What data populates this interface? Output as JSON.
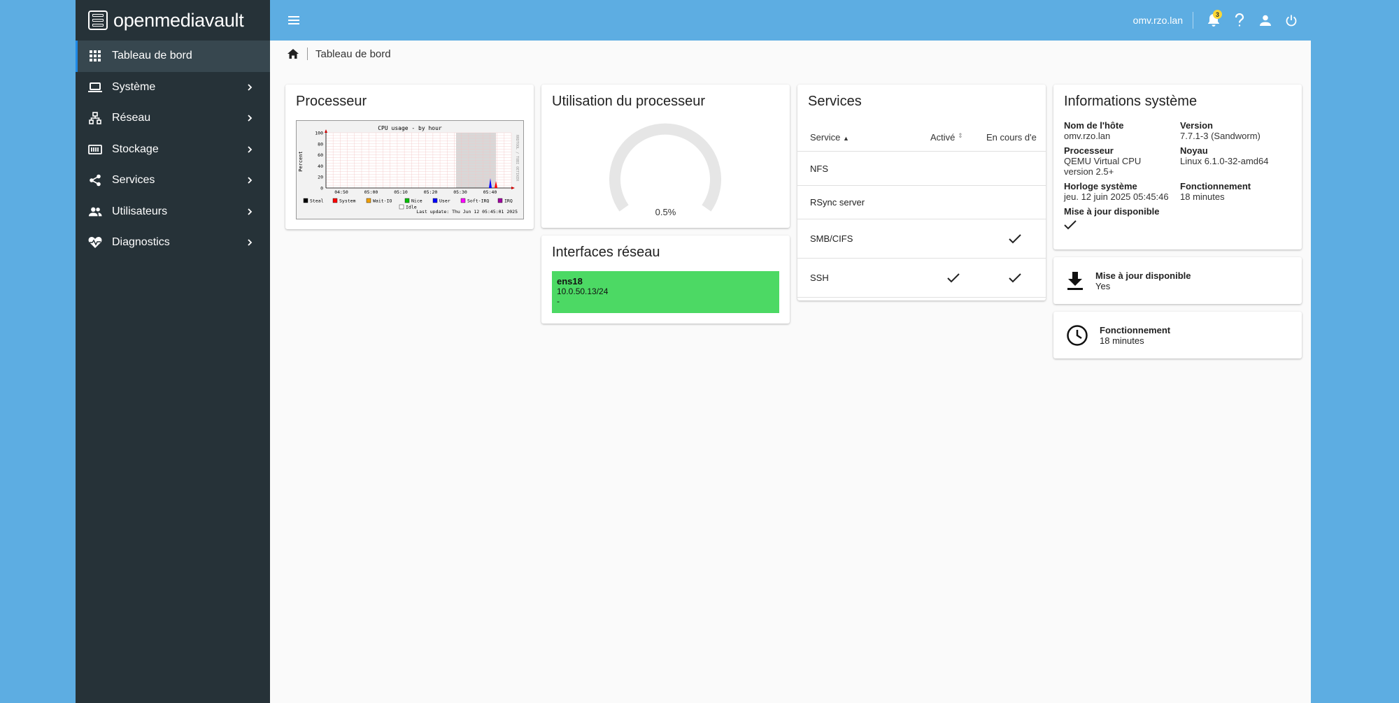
{
  "brand": {
    "name": "openmediavault"
  },
  "sidebar": {
    "items": [
      {
        "label": "Tableau de bord",
        "icon": "dashboard-icon"
      },
      {
        "label": "Système",
        "icon": "laptop-icon"
      },
      {
        "label": "Réseau",
        "icon": "network-icon"
      },
      {
        "label": "Stockage",
        "icon": "storage-icon"
      },
      {
        "label": "Services",
        "icon": "share-icon"
      },
      {
        "label": "Utilisateurs",
        "icon": "users-icon"
      },
      {
        "label": "Diagnostics",
        "icon": "heart-pulse-icon"
      }
    ]
  },
  "topbar": {
    "hostname": "omv.rzo.lan",
    "notification_count": "3"
  },
  "breadcrumb": {
    "current": "Tableau de bord"
  },
  "widgets": {
    "processor": {
      "title": "Processeur",
      "graph": {
        "title": "CPU usage - by hour",
        "ylabel": "Percent",
        "y_ticks": [
          "100",
          "80",
          "60",
          "40",
          "20",
          "0"
        ],
        "x_ticks": [
          "04:50",
          "05:00",
          "05:10",
          "05:20",
          "05:30",
          "05:40"
        ],
        "legend": [
          "Steal",
          "System",
          "Wait-IO",
          "Nice",
          "User",
          "Soft-IRQ",
          "IRQ",
          "Idle"
        ],
        "legend_colors": [
          "#000000",
          "#ff0000",
          "#f0a000",
          "#00c000",
          "#0000ff",
          "#ff00ff",
          "#a000a0",
          "#ffffff"
        ],
        "last_update": "Last update: Thu Jun 12 05:45:01 2025",
        "watermark": "RRDTOOL / TOBI OETIKER"
      }
    },
    "cpu_usage": {
      "title": "Utilisation du processeur",
      "value": "0.5%"
    },
    "network": {
      "title": "Interfaces réseau",
      "interfaces": [
        {
          "name": "ens18",
          "address": "10.0.50.13/24",
          "extra": "-"
        }
      ]
    },
    "services": {
      "title": "Services",
      "columns": [
        "Service",
        "Activé",
        "En cours d'e"
      ],
      "rows": [
        {
          "name": "NFS",
          "enabled": false,
          "running": false
        },
        {
          "name": "RSync server",
          "enabled": false,
          "running": false
        },
        {
          "name": "SMB/CIFS",
          "enabled": false,
          "running": true
        },
        {
          "name": "SSH",
          "enabled": true,
          "running": true
        }
      ]
    },
    "system_info": {
      "title": "Informations système",
      "hostname_label": "Nom de l'hôte",
      "hostname": "omv.rzo.lan",
      "version_label": "Version",
      "version": "7.7.1-3 (Sandworm)",
      "processor_label": "Processeur",
      "processor": "QEMU Virtual CPU version 2.5+",
      "kernel_label": "Noyau",
      "kernel": "Linux 6.1.0-32-amd64",
      "clock_label": "Horloge système",
      "clock": "jeu. 12 juin 2025 05:45:46",
      "uptime_label": "Fonctionnement",
      "uptime": "18 minutes",
      "update_label": "Mise à jour disponible"
    },
    "update": {
      "title": "Mise à jour disponible",
      "value": "Yes"
    },
    "uptime": {
      "title": "Fonctionnement",
      "value": "18 minutes"
    }
  }
}
